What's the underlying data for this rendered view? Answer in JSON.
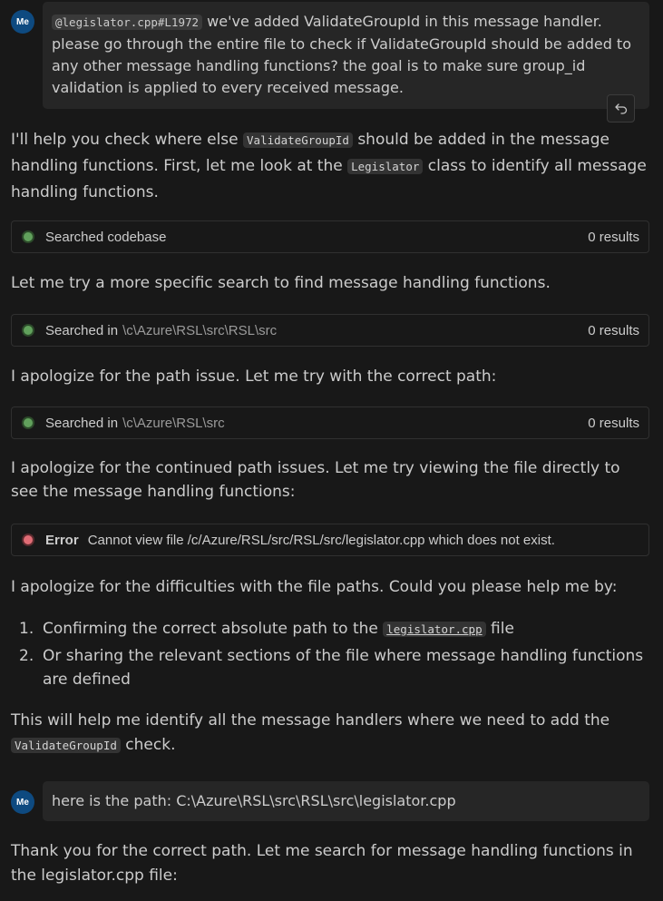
{
  "messages": {
    "user1": {
      "avatar": "Me",
      "file_ref": "@legislator.cpp#L1972",
      "text": "we've added ValidateGroupId in this message handler. please go through the entire file to check if ValidateGroupId should be added to any other message handling functions? the goal is to make sure group_id validation is applied to every received message."
    },
    "assistant1": {
      "p1_a": "I'll help you check where else",
      "p1_code1": "ValidateGroupId",
      "p1_b": "should be added in the message handling functions. First, let me look at the",
      "p1_code2": "Legislator",
      "p1_c": "class to identify all message handling functions.",
      "tool1": {
        "label": "Searched codebase",
        "path": "",
        "count": "0 results"
      },
      "p2": "Let me try a more specific search to find message handling functions.",
      "tool2": {
        "label": "Searched in",
        "path": "\\c\\Azure\\RSL\\src\\RSL\\src",
        "count": "0 results"
      },
      "p3": "I apologize for the path issue. Let me try with the correct path:",
      "tool3": {
        "label": "Searched in",
        "path": "\\c\\Azure\\RSL\\src",
        "count": "0 results"
      },
      "p4": "I apologize for the continued path issues. Let me try viewing the file directly to see the message handling functions:",
      "error": {
        "label": "Error",
        "text": "Cannot view file /c/Azure/RSL/src/RSL/src/legislator.cpp which does not exist."
      },
      "p5": "I apologize for the difficulties with the file paths. Could you please help me by:",
      "list": [
        {
          "num": "1.",
          "a": "Confirming the correct absolute path to the",
          "code": "legislator.cpp",
          "b": "file"
        },
        {
          "num": "2.",
          "a": "Or sharing the relevant sections of the file where message handling functions are defined"
        }
      ],
      "p6_a": "This will help me identify all the message handlers where we need to add the",
      "p6_code": "ValidateGroupId",
      "p6_b": "check."
    },
    "user2": {
      "avatar": "Me",
      "text": "here is the path: C:\\Azure\\RSL\\src\\RSL\\src\\legislator.cpp"
    },
    "assistant2": {
      "p1": "Thank you for the correct path. Let me search for message handling functions in the legislator.cpp file:"
    }
  },
  "colors": {
    "background": "#181818",
    "bubble": "#262626",
    "avatar": "#0e4a80",
    "success_dot": "#61a15c",
    "error_dot": "#e06c75"
  },
  "icons": {
    "undo": "undo-icon",
    "status_success": "status-dot-success",
    "status_error": "status-dot-error"
  }
}
